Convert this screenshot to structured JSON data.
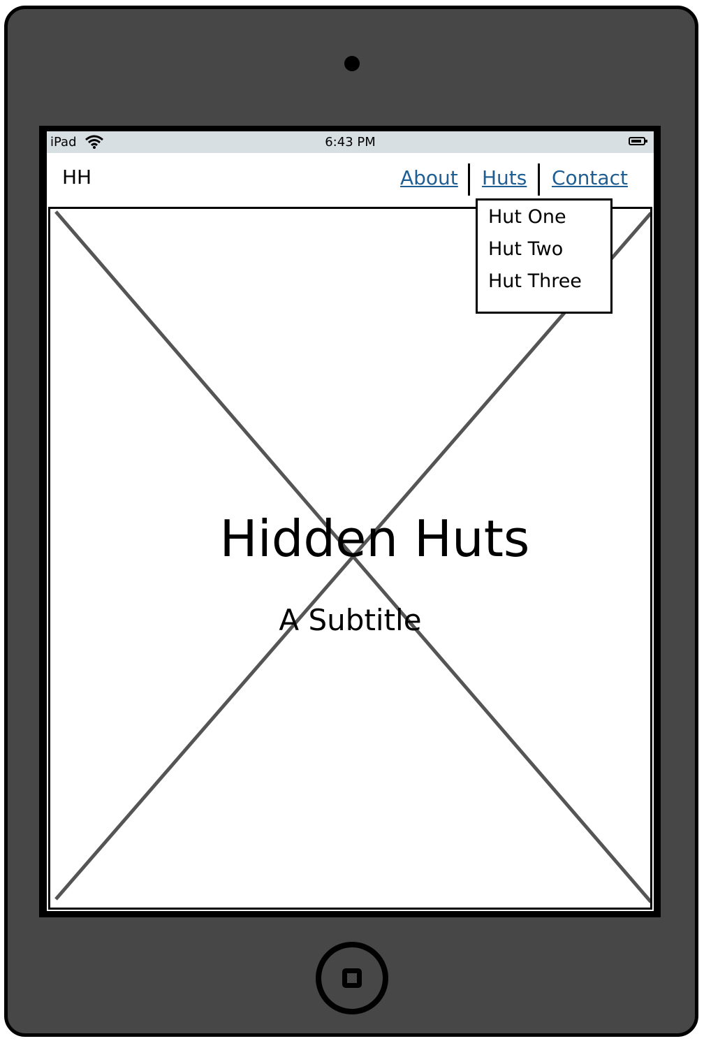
{
  "statusbar": {
    "carrier": "iPad",
    "time": "6:43 PM"
  },
  "navbar": {
    "brand": "HH",
    "links": [
      {
        "label": "About"
      },
      {
        "label": "Huts"
      },
      {
        "label": "Contact"
      }
    ]
  },
  "dropdown": {
    "items": [
      "Hut One",
      "Hut Two",
      "Hut Three"
    ]
  },
  "hero": {
    "title": "Hidden Huts",
    "subtitle": "A Subtitle"
  },
  "colors": {
    "frame": "#474747",
    "statusbar": "#d8dfe3",
    "link": "#1f5e93",
    "placeholder_line": "#555555"
  }
}
